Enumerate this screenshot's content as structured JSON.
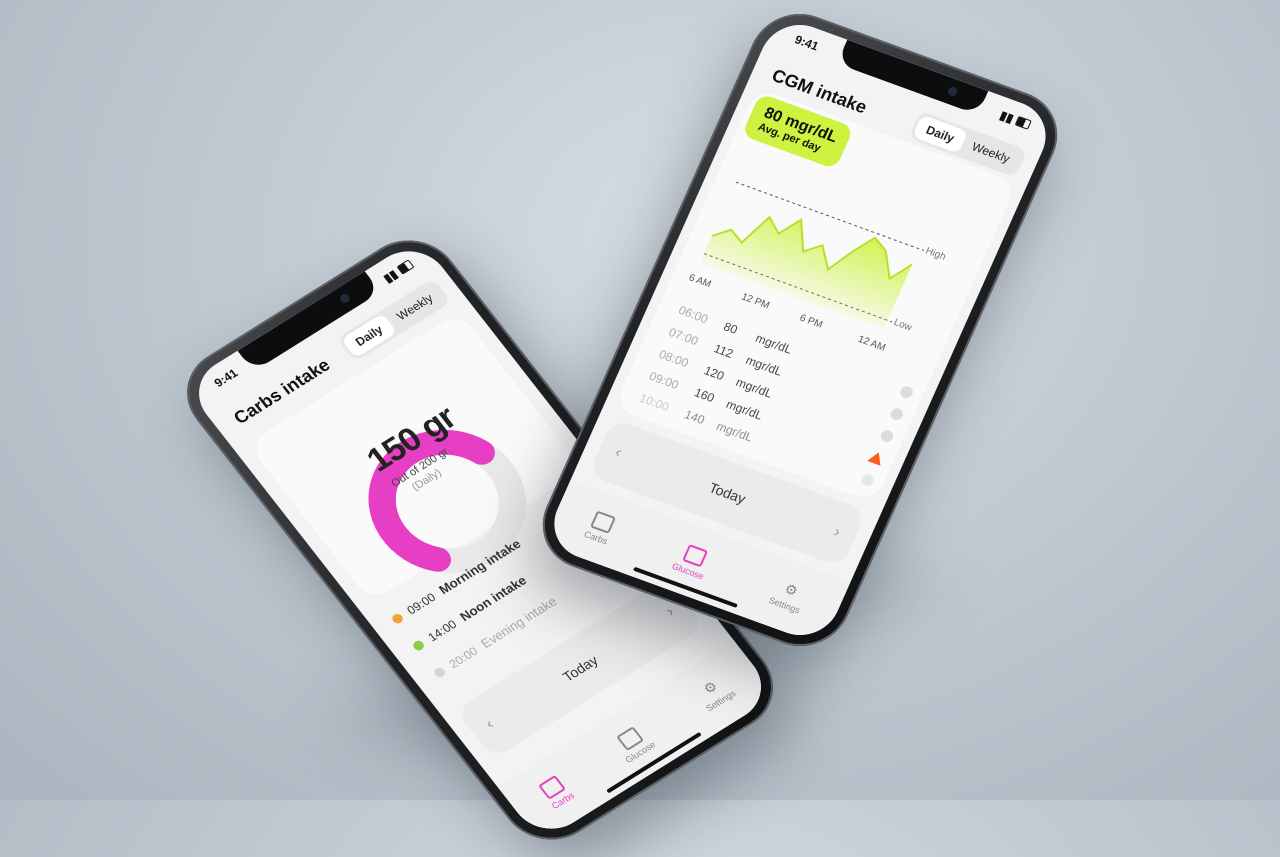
{
  "status": {
    "time": "9:41"
  },
  "carbs": {
    "title": "Carbs intake",
    "tabs": [
      {
        "label": "Daily",
        "active": true
      },
      {
        "label": "Weekly",
        "active": false
      }
    ],
    "gauge": {
      "value": "150 gr",
      "subtitle": "Out of 200 gr",
      "period": "(Daily)",
      "fraction": 0.75,
      "color": "#e63ec4"
    },
    "intakes": [
      {
        "time": "09:00",
        "name": "Morning intake",
        "status": "done",
        "color": "#f2a33a"
      },
      {
        "time": "14:00",
        "name": "Noon intake",
        "status": "done",
        "color": "#8fc94a"
      },
      {
        "time": "20:00",
        "name": "Evening intake",
        "status": "pending",
        "color": "#bdbdbd"
      }
    ],
    "date_label": "Today",
    "nav_prev": "‹",
    "nav_next": "›"
  },
  "cgm": {
    "title": "CGM intake",
    "tabs": [
      {
        "label": "Daily",
        "active": true
      },
      {
        "label": "Weekly",
        "active": false
      }
    ],
    "average": {
      "value": "80 mgr/dL",
      "label": "Avg. per day",
      "color": "#cdf23f"
    },
    "chart_data": {
      "type": "area",
      "x": [
        "6 AM",
        "12 PM",
        "6 PM",
        "12 AM"
      ],
      "threshold_labels": [
        "High",
        "Low"
      ],
      "series": [
        {
          "values": [
            95,
            110,
            100,
            140,
            125,
            150,
            115,
            130,
            105,
            135,
            160,
            150,
            120,
            145
          ]
        }
      ]
    },
    "readings": [
      {
        "time": "06:00",
        "value": "80",
        "unit": "mgr/dL",
        "status": "ok"
      },
      {
        "time": "07:00",
        "value": "112",
        "unit": "mgr/dL",
        "status": "ok"
      },
      {
        "time": "08:00",
        "value": "120",
        "unit": "mgr/dL",
        "status": "ok"
      },
      {
        "time": "09:00",
        "value": "160",
        "unit": "mgr/dL",
        "status": "warning"
      },
      {
        "time": "10:00",
        "value": "140",
        "unit": "mgr/dL",
        "status": "ok"
      }
    ],
    "date_label": "Today",
    "nav_prev": "‹",
    "nav_next": "›"
  },
  "tabbar": [
    {
      "label": "Carbs",
      "icon": "carbs-icon"
    },
    {
      "label": "Glucose",
      "icon": "glucose-icon"
    },
    {
      "label": "Settings",
      "icon": "gear-icon"
    }
  ]
}
